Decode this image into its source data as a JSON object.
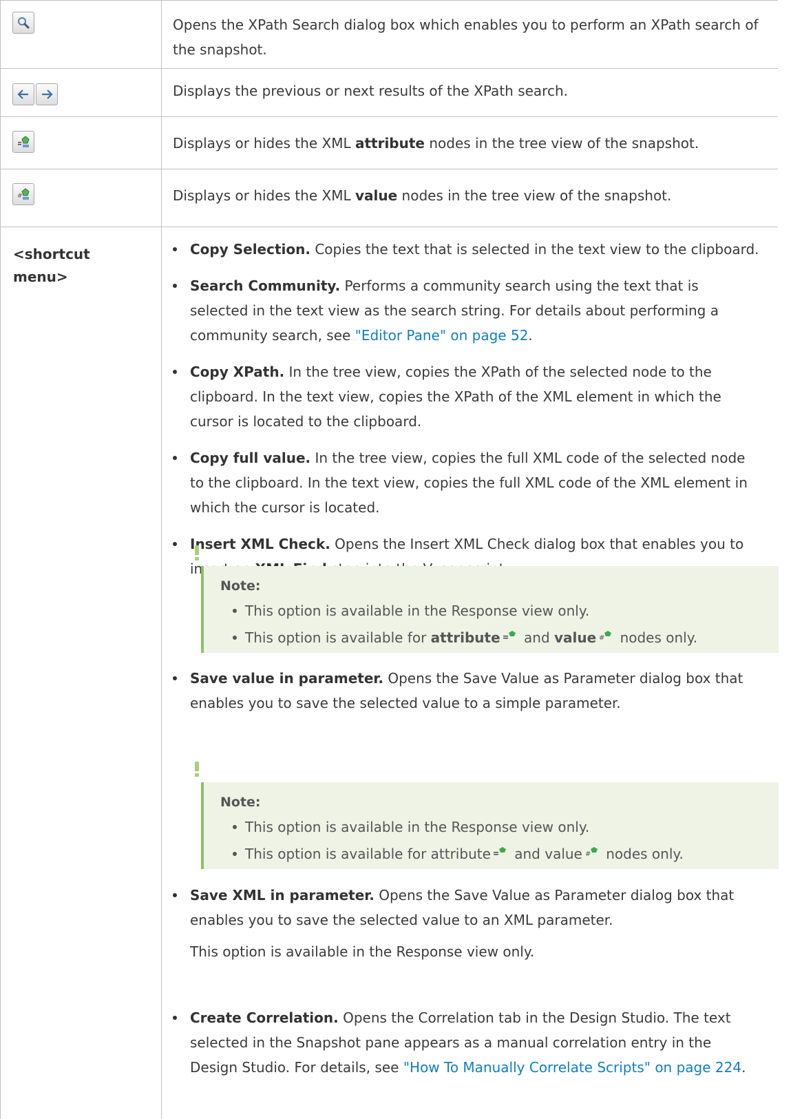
{
  "rows": {
    "search": {
      "icon": "magnifier-icon",
      "description": "Opens the XPath Search dialog box which enables you to perform an XPath search of the snapshot."
    },
    "nav": {
      "icons": [
        "left-arrow-icon",
        "right-arrow-icon"
      ],
      "description": "Displays the previous or next results of the XPath search."
    },
    "attribute": {
      "icon": "attribute-nodes-icon",
      "description_pre": "Displays or hides the XML ",
      "description_bold": "attribute",
      "description_post": " nodes in the tree view of the snapshot."
    },
    "value": {
      "icon": "value-nodes-icon",
      "description_pre": "Displays or hides the XML ",
      "description_bold": "value",
      "description_post": " nodes in the tree view of the snapshot."
    },
    "shortcut": {
      "label_line1": "<shortcut",
      "label_line2": "menu>",
      "items": [
        {
          "bold": "Copy Selection.",
          "line1": " Copies the text that is selected in the text view to the clipboard."
        },
        {
          "bold": "Search Community.",
          "line1": " Performs a community search using the text that is",
          "line2": "selected in the text view as the search string. For details about performing a",
          "line3_pre": "community search, see ",
          "line3_link": "\"Editor Pane\" on page 52",
          "line3_post": "."
        },
        {
          "bold": "Copy XPath.",
          "line1": " In the tree view, copies the XPath of the selected node to the",
          "line2": "clipboard. In the text view, copies the XPath of the XML element in which the",
          "line3": "cursor is located to the clipboard."
        },
        {
          "bold": "Copy full value.",
          "line1": " In the tree view, copies the full XML code of the selected node",
          "line2": "to the clipboard. In the text view, copies the full XML code of the XML element in",
          "line3": "which the cursor is located."
        },
        {
          "bold": "Insert XML Check.",
          "line1": " Opens the Insert XML Check dialog box that enables you to",
          "line2_pre": "insert an ",
          "line2_bold": "XML Find",
          "line2_post": " step into the Vuser script."
        },
        {
          "bold": "Save value in parameter.",
          "line1": " Opens the Save Value as Parameter dialog box that",
          "line2": "enables you to save the selected value to a simple parameter."
        },
        {
          "bold": "Save XML in parameter.",
          "line1": " Opens the Save Value as Parameter dialog box that",
          "line2": "enables you to save the selected value to an XML parameter.",
          "line3": "This option is available in the Response view only."
        },
        {
          "bold": "Create Correlation.",
          "line1": " Opens the Correlation tab in the Design Studio. The text",
          "line2": "selected in the Snapshot pane appears as a manual correlation entry in the",
          "line3_pre": "Design Studio. For details, see ",
          "line3_link": "\"How To Manually Correlate Scripts\" on page 224",
          "line3_post": "."
        }
      ],
      "note1": {
        "title": "Note:",
        "item1": "This option is available in the Response view only.",
        "item2_pre": "This option is available for ",
        "item2_bold1": "attribute",
        "item2_mid": " and ",
        "item2_bold2": "value",
        "item2_post": " nodes only."
      },
      "note2": {
        "title": "Note:",
        "item1": "This option is available in the Response view only.",
        "item2_pre": "This option is available for attribute",
        "item2_mid": " and value",
        "item2_post": " nodes only."
      }
    }
  }
}
